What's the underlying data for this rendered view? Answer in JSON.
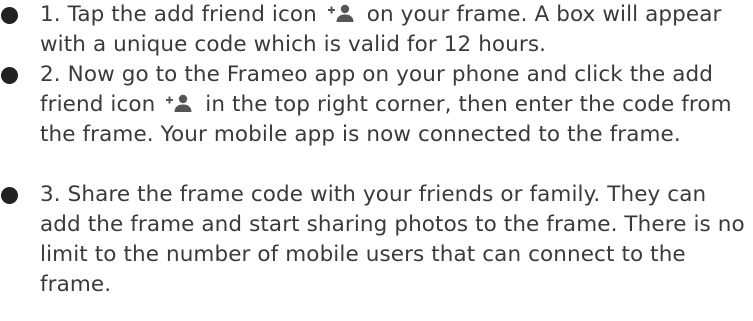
{
  "steps": [
    {
      "before": "1. Tap the add friend icon ",
      "after": " on your frame. A box will appear with a unique code which is valid for 12 hours.",
      "icon": "add-friend-icon"
    },
    {
      "before": "2. Now go to the Frameo app on your phone and click the add friend icon ",
      "after": " in the top right corner, then enter the code from the frame. Your mobile app is now connected to the frame.",
      "icon": "add-friend-icon"
    },
    {
      "text": "3. Share the frame code with your friends or family. They can add the frame and start sharing photos to the frame. There is no limit to the number of mobile users that can connect to the frame."
    }
  ],
  "colors": {
    "text": "#3a3a3a",
    "bullet": "#222222",
    "icon": "#555555"
  }
}
